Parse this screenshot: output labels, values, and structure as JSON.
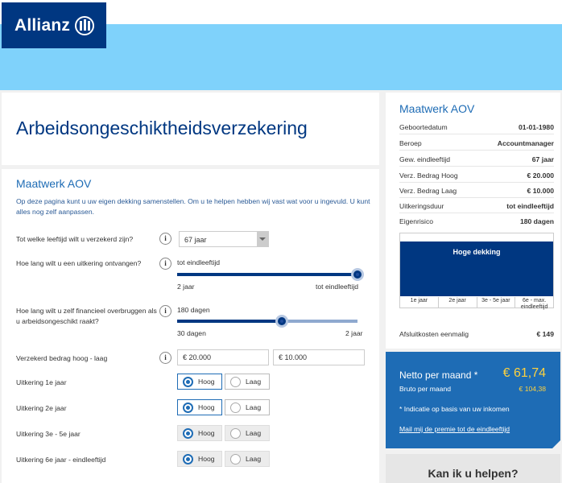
{
  "brand": {
    "name": "Allianz",
    "mark": "logo-mark"
  },
  "colors": {
    "navy": "#003781",
    "blue": "#1e6cb5",
    "sky": "#7fd2fb",
    "gold": "#fdd13f"
  },
  "page": {
    "title": "Arbeidsongeschiktheidsverzekering"
  },
  "main": {
    "section_title": "Maatwerk AOV",
    "intro": "Op deze pagina kunt u uw eigen dekking samenstellen. Om u te helpen hebben wij vast wat voor u ingevuld. U kunt alles nog zelf aanpassen.",
    "q_age": {
      "label": "Tot welke leeftijd wilt u verzekerd zijn?",
      "value": "67 jaar"
    },
    "q_benefit": {
      "label": "Hoe lang wilt u een uitkering ontvangen?",
      "value": "tot eindleeftijd",
      "min": "2 jaar",
      "max": "tot eindleeftijd",
      "level": 1.0
    },
    "q_bridge": {
      "label": "Hoe lang wilt u zelf financieel overbruggen als u arbeidsongeschikt raakt?",
      "value": "180 dagen",
      "min": "30 dagen",
      "max": "2 jaar",
      "level": 0.58
    },
    "q_amount": {
      "label": "Verzekerd bedrag hoog - laag",
      "high": "€ 20.000",
      "low": "€ 10.000"
    },
    "payouts": [
      {
        "label": "Uitkering 1e jaar",
        "selected": "Hoog",
        "disabled": false
      },
      {
        "label": "Uitkering 2e jaar",
        "selected": "Hoog",
        "disabled": false
      },
      {
        "label": "Uitkering 3e - 5e jaar",
        "selected": "Hoog",
        "disabled": true
      },
      {
        "label": "Uitkering 6e jaar - eindleeftijd",
        "selected": "Hoog",
        "disabled": true
      }
    ],
    "opt_high": "Hoog",
    "opt_low": "Laag",
    "info_glyph": "i"
  },
  "summary": {
    "title": "Maatwerk AOV",
    "rows": [
      {
        "k": "Geboortedatum",
        "v": "01-01-1980"
      },
      {
        "k": "Beroep",
        "v": "Accountmanager"
      },
      {
        "k": "Gew. eindleeftijd",
        "v": "67 jaar"
      },
      {
        "k": "Verz. Bedrag Hoog",
        "v": "€ 20.000"
      },
      {
        "k": "Verz. Bedrag Laag",
        "v": "€ 10.000"
      },
      {
        "k": "Uitkeringsduur",
        "v": "tot eindleeftijd"
      },
      {
        "k": "Eigenrisico",
        "v": "180 dagen"
      }
    ],
    "coverage_label": "Hoge dekking",
    "periods": [
      "1e jaar",
      "2e jaar",
      "3e - 5e jaar",
      "6e - max. eindleeftijd"
    ],
    "closing_cost_label": "Afsluitkosten eenmalig",
    "closing_cost": "€ 149"
  },
  "price": {
    "net_label": "Netto per maand *",
    "net": "€ 61,74",
    "gross_label": "Bruto per maand",
    "gross": "€ 104,38",
    "note": "* Indicatie op basis van uw inkomen",
    "mail_link": "Mail mij de premie tot de eindleeftijd"
  },
  "help": {
    "title": "Kan ik u helpen?"
  }
}
